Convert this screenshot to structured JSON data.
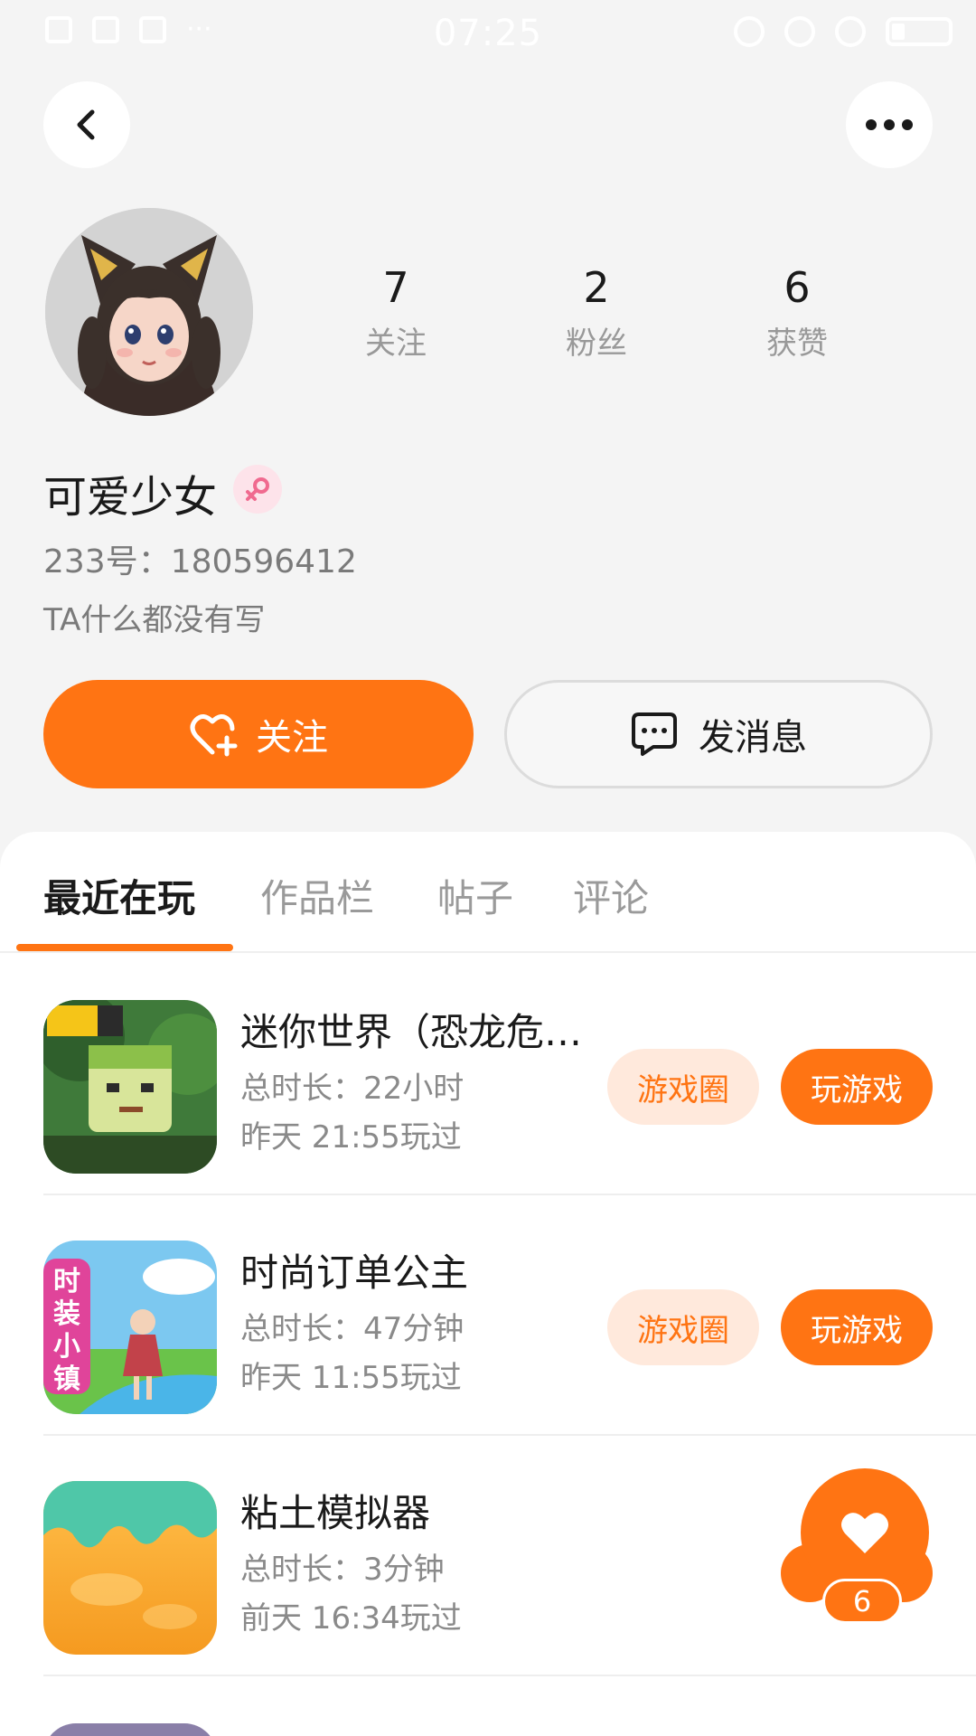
{
  "status_bar": {
    "time": "07:25"
  },
  "header": {
    "back_icon": "chevron-left-icon",
    "more_icon": "more-horizontal-icon"
  },
  "profile": {
    "avatar": "cat-ear-girl-avatar",
    "stats": [
      {
        "value": "7",
        "label": "关注"
      },
      {
        "value": "2",
        "label": "粉丝"
      },
      {
        "value": "6",
        "label": "获赞"
      }
    ],
    "username": "可爱少女",
    "gender_icon": "female-icon",
    "uid": "233号：180596412",
    "bio": "TA什么都没有写",
    "follow_label": "关注",
    "message_label": "发消息"
  },
  "tabs": [
    {
      "label": "最近在玩",
      "active": true
    },
    {
      "label": "作品栏",
      "active": false
    },
    {
      "label": "帖子",
      "active": false
    },
    {
      "label": "评论",
      "active": false
    }
  ],
  "games": [
    {
      "name": "迷你世界（恐龙危…",
      "total_time": "总时长：22小时",
      "last_played": "昨天 21:55玩过",
      "circle_label": "游戏圈",
      "play_label": "玩游戏"
    },
    {
      "name": "时尚订单公主",
      "total_time": "总时长：47分钟",
      "last_played": "昨天 11:55玩过",
      "circle_label": "游戏圈",
      "play_label": "玩游戏",
      "icon_text": "时装小镇"
    },
    {
      "name": "粘土模拟器",
      "total_time": "总时长：3分钟",
      "last_played": "前天 16:34玩过"
    }
  ],
  "like_button": {
    "count": "6",
    "icon": "heart-icon"
  },
  "colors": {
    "accent": "#ff7413",
    "accent_light": "#ffe9dc",
    "background": "#f4f4f4"
  }
}
